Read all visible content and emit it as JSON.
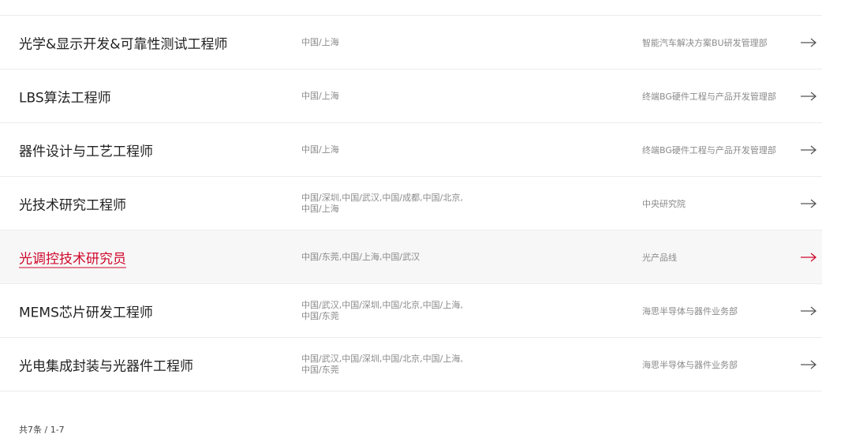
{
  "jobs": [
    {
      "title": "光学&显示开发&可靠性测试工程师",
      "location": "中国/上海",
      "department": "智能汽车解决方案BU研发管理部",
      "active": false
    },
    {
      "title": "LBS算法工程师",
      "location": "中国/上海",
      "department": "终端BG硬件工程与产品开发管理部",
      "active": false
    },
    {
      "title": "器件设计与工艺工程师",
      "location": "中国/上海",
      "department": "终端BG硬件工程与产品开发管理部",
      "active": false
    },
    {
      "title": "光技术研究工程师",
      "location": "中国/深圳,中国/武汉,中国/成都,中国/北京,中国/上海",
      "department": "中央研究院",
      "active": false
    },
    {
      "title": "光调控技术研究员",
      "location": "中国/东莞,中国/上海,中国/武汉",
      "department": "光产品线",
      "active": true
    },
    {
      "title": "MEMS芯片研发工程师",
      "location": "中国/武汉,中国/深圳,中国/北京,中国/上海,中国/东莞",
      "department": "海思半导体与器件业务部",
      "active": false
    },
    {
      "title": "光电集成封装与光器件工程师",
      "location": "中国/武汉,中国/深圳,中国/北京,中国/上海,中国/东莞",
      "department": "海思半导体与器件业务部",
      "active": false
    }
  ],
  "pagination": {
    "summary": "共7条 / 1-7"
  },
  "colors": {
    "accent": "#cf0a2c",
    "arrow_default": "#555555",
    "text_muted": "#8a8a8a",
    "divider": "#ececec"
  },
  "icons": {
    "row_arrow": "arrow-right-icon"
  }
}
